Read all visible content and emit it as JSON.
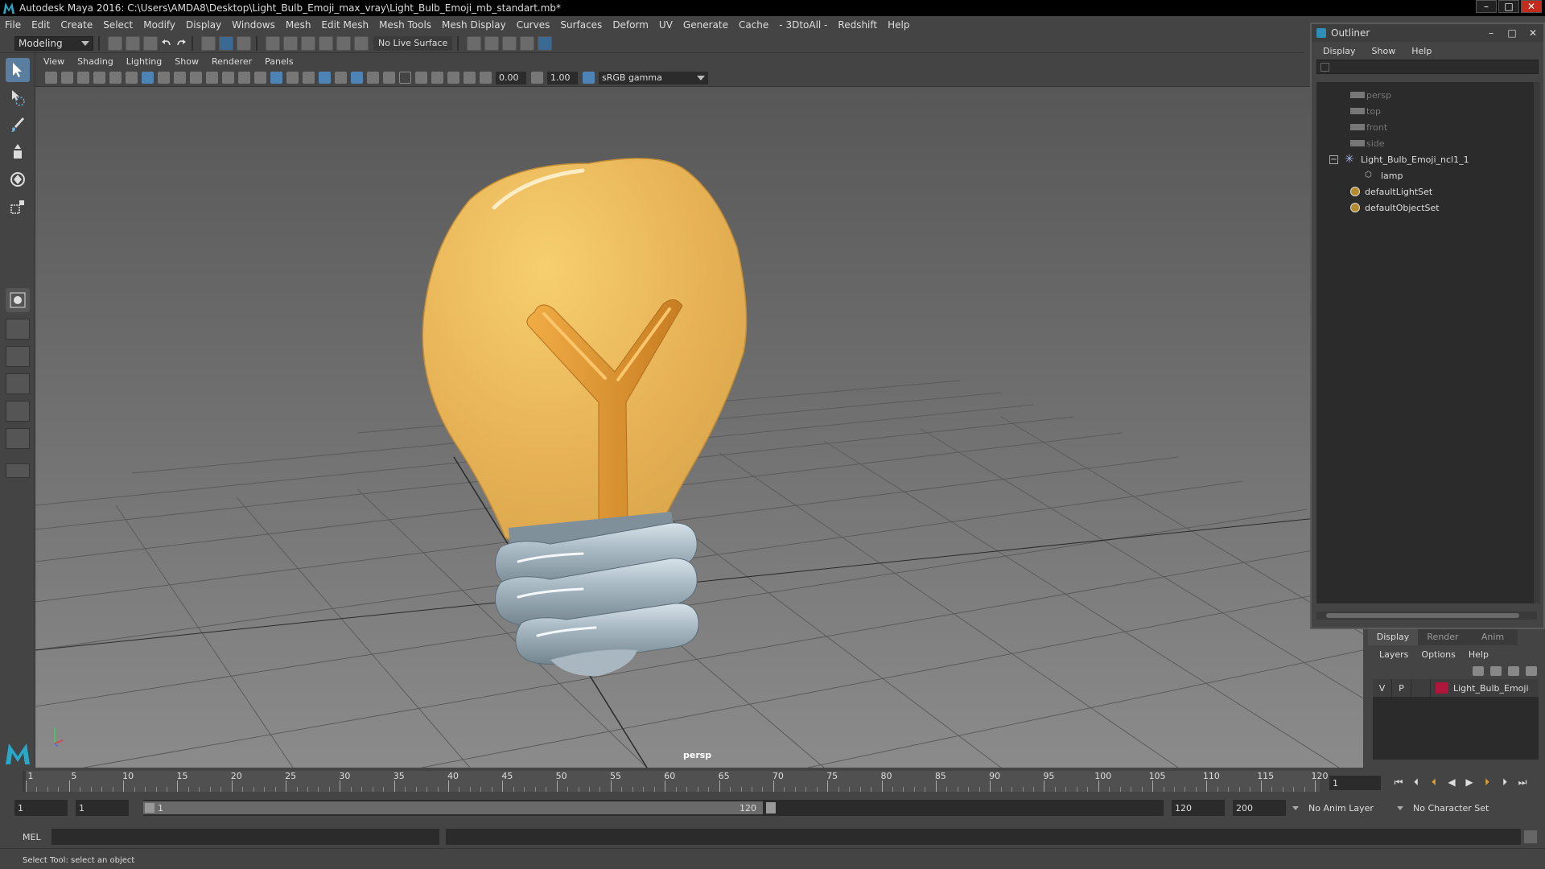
{
  "window": {
    "title": "Autodesk Maya 2016: C:\\Users\\AMDA8\\Desktop\\Light_Bulb_Emoji_max_vray\\Light_Bulb_Emoji_mb_standart.mb*"
  },
  "menubar": [
    "File",
    "Edit",
    "Create",
    "Select",
    "Modify",
    "Display",
    "Windows",
    "Mesh",
    "Edit Mesh",
    "Mesh Tools",
    "Mesh Display",
    "Curves",
    "Surfaces",
    "Deform",
    "UV",
    "Generate",
    "Cache",
    "- 3DtoAll -",
    "Redshift",
    "Help"
  ],
  "statusline": {
    "mode": "Modeling",
    "live_surface": "No Live Surface"
  },
  "panel": {
    "menu": [
      "View",
      "Shading",
      "Lighting",
      "Show",
      "Renderer",
      "Panels"
    ],
    "exposure": "0.00",
    "gamma_value": "1.00",
    "color_space": "sRGB gamma",
    "camera_label": "persp"
  },
  "outliner": {
    "title": "Outliner",
    "menu": [
      "Display",
      "Show",
      "Help"
    ],
    "items": [
      {
        "label": "persp",
        "type": "camera"
      },
      {
        "label": "top",
        "type": "camera"
      },
      {
        "label": "front",
        "type": "camera"
      },
      {
        "label": "side",
        "type": "camera"
      },
      {
        "label": "Light_Bulb_Emoji_ncl1_1",
        "type": "group"
      },
      {
        "label": "lamp",
        "type": "mesh"
      },
      {
        "label": "defaultLightSet",
        "type": "set"
      },
      {
        "label": "defaultObjectSet",
        "type": "set"
      }
    ]
  },
  "layers": {
    "tabs": [
      "Display",
      "Render",
      "Anim"
    ],
    "active_tab": "Display",
    "menu": [
      "Layers",
      "Options",
      "Help"
    ],
    "rows": [
      {
        "visible": "V",
        "playback": "P",
        "name": "Light_Bulb_Emoji",
        "color": "#b0163b"
      }
    ]
  },
  "timeslider": {
    "labels": [
      "1",
      "5",
      "10",
      "15",
      "20",
      "25",
      "30",
      "35",
      "40",
      "45",
      "50",
      "55",
      "60",
      "65",
      "70",
      "75",
      "80",
      "85",
      "90",
      "95",
      "100",
      "105",
      "110",
      "115",
      "120"
    ],
    "current_frame": "1"
  },
  "rangeslider": {
    "start_time": "1",
    "playback_start": "1",
    "range_start": "1",
    "range_end": "120",
    "playback_end": "120",
    "end_time": "200",
    "anim_layer": "No Anim Layer",
    "character_set": "No Character Set"
  },
  "commandline": {
    "label": "MEL"
  },
  "helpline": {
    "text": "Select Tool: select an object"
  },
  "colors": {
    "bulb": "#e7b256",
    "filament": "#d8912d",
    "base": "#9fb0bb",
    "accent": "#5a7ea0"
  }
}
